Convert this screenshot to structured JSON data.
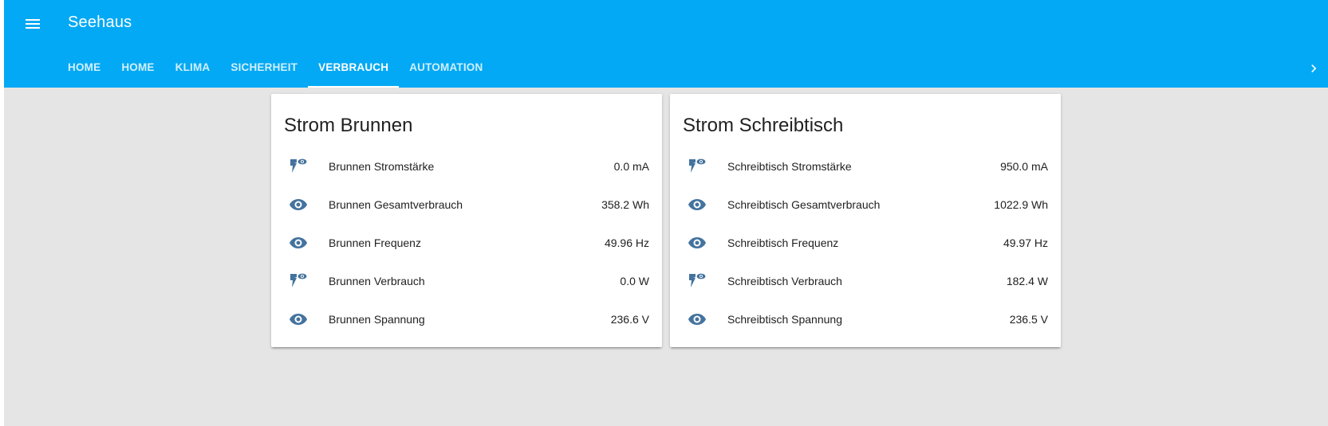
{
  "header": {
    "title": "Seehaus",
    "menu_icon": "menu-icon",
    "scroll_icon": "chevron-right-icon",
    "color": "#03a9f4"
  },
  "tabs": [
    {
      "label": "HOME",
      "active": false
    },
    {
      "label": "HOME",
      "active": false
    },
    {
      "label": "KLIMA",
      "active": false
    },
    {
      "label": "SICHERHEIT",
      "active": false
    },
    {
      "label": "VERBRAUCH",
      "active": true
    },
    {
      "label": "AUTOMATION",
      "active": false
    }
  ],
  "cards": [
    {
      "title": "Strom Brunnen",
      "rows": [
        {
          "icon": "flash-eye-icon",
          "name": "Brunnen Stromstärke",
          "value": "0.0 mA"
        },
        {
          "icon": "eye-icon",
          "name": "Brunnen Gesamtverbrauch",
          "value": "358.2 Wh"
        },
        {
          "icon": "eye-icon",
          "name": "Brunnen Frequenz",
          "value": "49.96 Hz"
        },
        {
          "icon": "flash-eye-icon",
          "name": "Brunnen Verbrauch",
          "value": "0.0 W"
        },
        {
          "icon": "eye-icon",
          "name": "Brunnen Spannung",
          "value": "236.6 V"
        }
      ]
    },
    {
      "title": "Strom Schreibtisch",
      "rows": [
        {
          "icon": "flash-eye-icon",
          "name": "Schreibtisch Stromstärke",
          "value": "950.0 mA"
        },
        {
          "icon": "eye-icon",
          "name": "Schreibtisch Gesamtverbrauch",
          "value": "1022.9 Wh"
        },
        {
          "icon": "eye-icon",
          "name": "Schreibtisch Frequenz",
          "value": "49.97 Hz"
        },
        {
          "icon": "flash-eye-icon",
          "name": "Schreibtisch Verbrauch",
          "value": "182.4 W"
        },
        {
          "icon": "eye-icon",
          "name": "Schreibtisch Spannung",
          "value": "236.5 V"
        }
      ]
    }
  ],
  "icon_color": "#44739e"
}
